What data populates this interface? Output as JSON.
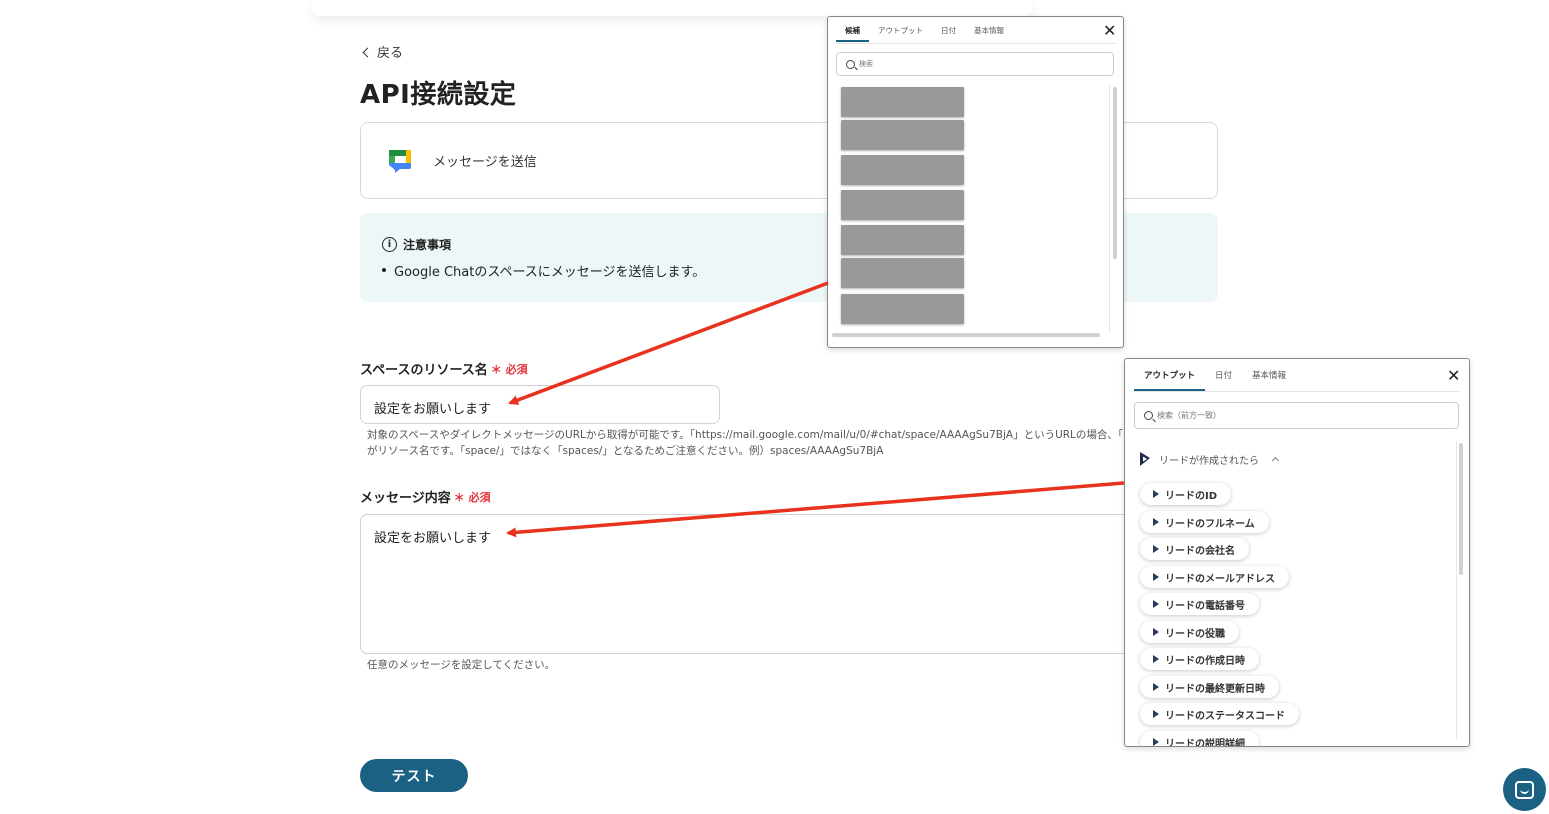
{
  "page": {
    "back_label": "戻る",
    "title": "API接続設定"
  },
  "action": {
    "label": "メッセージを送信",
    "icon": "google-chat-icon"
  },
  "notice": {
    "heading": "注意事項",
    "items": [
      "Google Chatのスペースにメッセージを送信します。"
    ]
  },
  "fields": {
    "space": {
      "label": "スペースのリソース名",
      "required": "必須",
      "value": "設定をお願いします",
      "help_line1": "対象のスペースやダイレクトメッセージのURLから取得が可能です。「https://mail.google.com/mail/u/0/#chat/space/AAAAgSu7BjA」というURLの場合、「spac",
      "help_line2": "がリソース名です。「space/」ではなく「spaces/」となるためご注意ください。例）spaces/AAAAgSu7BjA"
    },
    "message": {
      "label": "メッセージ内容",
      "required": "必須",
      "value": "設定をお願いします",
      "help": "任意のメッセージを設定してください。"
    }
  },
  "test_button": "テスト",
  "popup_candidates": {
    "tabs": [
      "候補",
      "アウトプット",
      "日付",
      "基本情報"
    ],
    "active_tab": "候補",
    "search_placeholder": "検索",
    "close": "✕"
  },
  "popup_outputs": {
    "tabs": [
      "アウトプット",
      "日付",
      "基本情報"
    ],
    "active_tab": "アウトプット",
    "search_placeholder": "検索（前方一致）",
    "close": "✕",
    "trigger": "リードが作成されたら",
    "chips": [
      "リードのID",
      "リードのフルネーム",
      "リードの会社名",
      "リードのメールアドレス",
      "リードの電話番号",
      "リードの役職",
      "リードの作成日時",
      "リードの最終更新日時",
      "リードのステータスコード",
      "リードの説明詳細"
    ]
  },
  "colors": {
    "accent": "#1a6183",
    "required": "#e5333d",
    "arrow": "#e8321e",
    "notice_bg": "#eef7f7"
  }
}
